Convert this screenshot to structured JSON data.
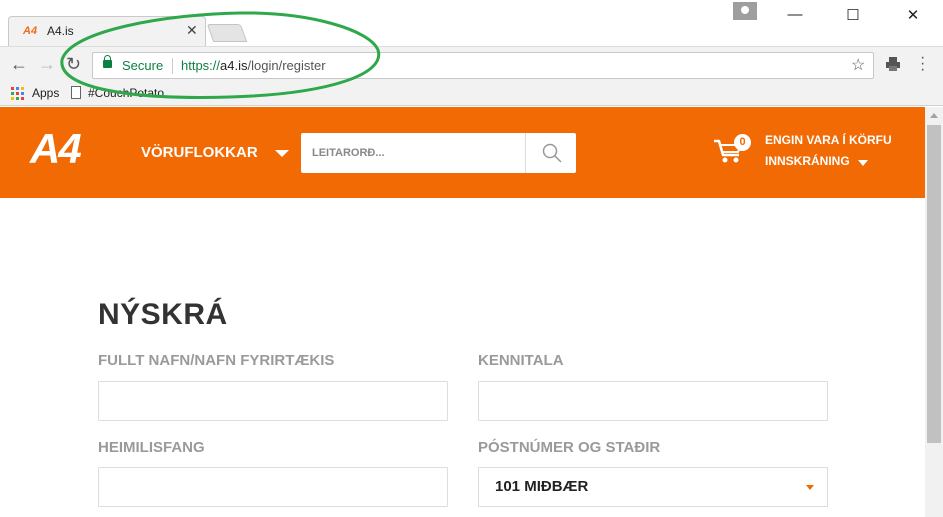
{
  "browser": {
    "tab_title": "A4.is",
    "tab_favicon": "A4",
    "address": {
      "secure_label": "Secure",
      "url_scheme": "https://",
      "url_domain": "a4.is",
      "url_path": "/login/register"
    },
    "bookmarks": [
      {
        "label": "Apps",
        "icon": "apps-grid-icon"
      },
      {
        "label": "#CouchPotato",
        "icon": "page-icon"
      }
    ]
  },
  "header": {
    "logo": "A4",
    "categories_label": "VÖRUFLOKKAR",
    "search_placeholder": "LEITARORÐ...",
    "cart_count": "0",
    "cart_text": "ENGIN VARA Í KÖRFU",
    "login_text": "INNSKRÁNING"
  },
  "form": {
    "title": "NÝSKRÁ",
    "fields": [
      {
        "label": "FULLT NAFN/NAFN FYRIRTÆKIS",
        "value": ""
      },
      {
        "label": "KENNITALA",
        "value": ""
      },
      {
        "label": "HEIMILISFANG",
        "value": ""
      },
      {
        "label": "PÓSTNÚMER OG STAÐIR",
        "value": "101 MIÐBÆR"
      }
    ]
  },
  "colors": {
    "brand_orange": "#f26a04",
    "secure_green": "#0b8043",
    "annotation_green": "#2ea84a"
  }
}
